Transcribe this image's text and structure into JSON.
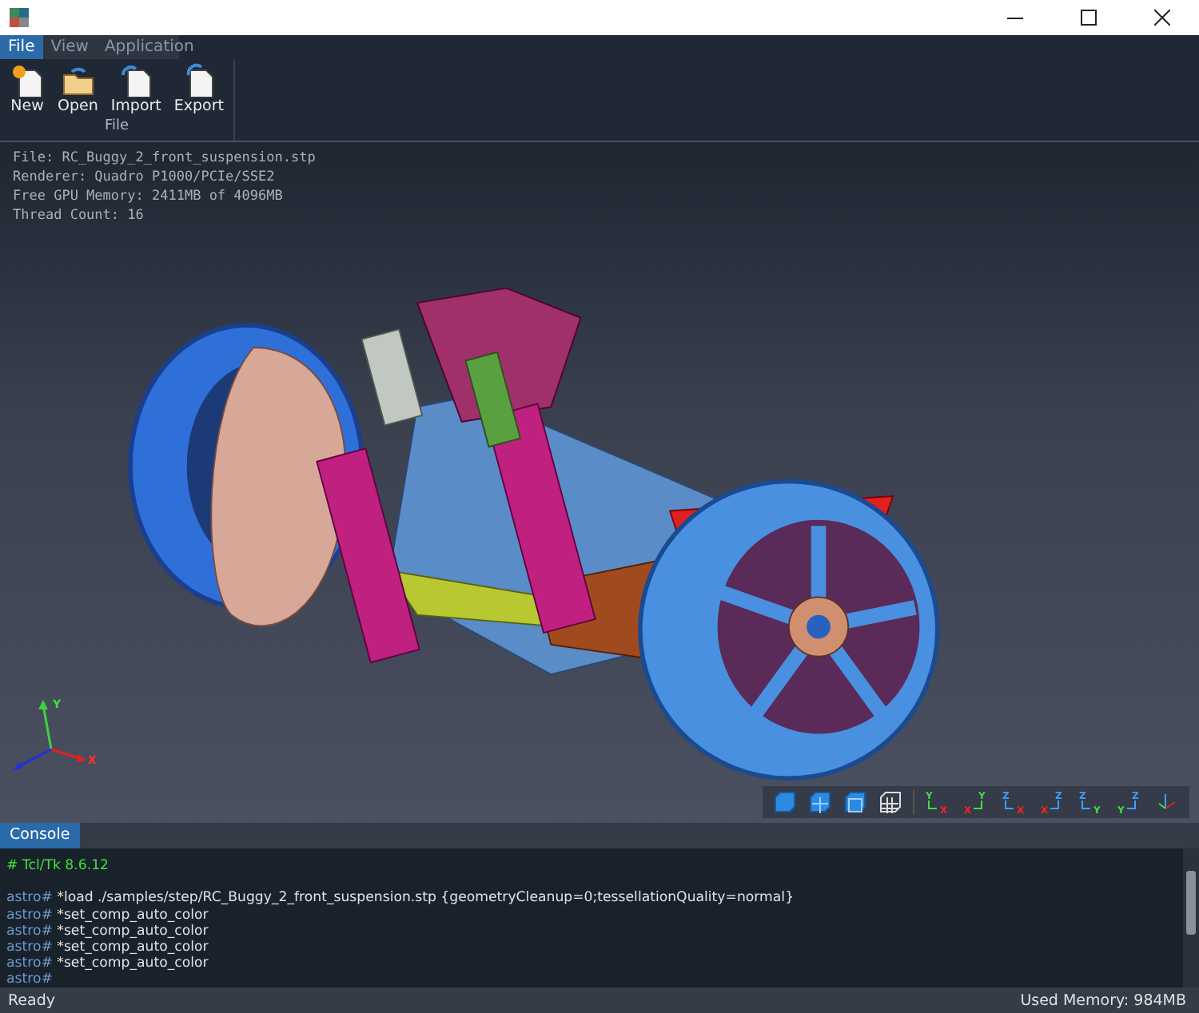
{
  "menu_tabs": [
    {
      "label": "File",
      "selected": true
    },
    {
      "label": "View",
      "selected": false
    },
    {
      "label": "Application",
      "selected": false
    }
  ],
  "ribbon": {
    "buttons": [
      {
        "label": "New",
        "kind": "new"
      },
      {
        "label": "Open",
        "kind": "open"
      },
      {
        "label": "Import",
        "kind": "import"
      },
      {
        "label": "Export",
        "kind": "export"
      }
    ],
    "group_label": "File"
  },
  "viewport_info": [
    "File: RC_Buggy_2_front_suspension.stp",
    "Renderer: Quadro P1000/PCIe/SSE2",
    "Free GPU Memory: 2411MB of 4096MB",
    "Thread Count: 16"
  ],
  "axis_triad": {
    "y_label": "Y",
    "x_label": "X"
  },
  "view_buttons": [
    {
      "kind": "shaded"
    },
    {
      "kind": "shaded-edges"
    },
    {
      "kind": "shaded-outline"
    },
    {
      "kind": "wireframe"
    }
  ],
  "axis_views": [
    {
      "up": "Y",
      "side": "X"
    },
    {
      "up": "Y",
      "side": "X"
    },
    {
      "up": "Z",
      "side": "X"
    },
    {
      "up": "Z",
      "side": "X"
    },
    {
      "up": "Z",
      "side": "Y"
    },
    {
      "up": "Z",
      "side": "Y"
    }
  ],
  "console_tab": {
    "label": "Console",
    "selected": true
  },
  "console_lines": [
    {
      "kind": "comment",
      "text": "# Tcl/Tk 8.6.12"
    },
    {
      "kind": "blank"
    },
    {
      "kind": "command",
      "prompt": "astro#",
      "text": "*load ./samples/step/RC_Buggy_2_front_suspension.stp {geometryCleanup=0;tessellationQuality=normal}"
    },
    {
      "kind": "command",
      "prompt": "astro#",
      "text": "*set_comp_auto_color"
    },
    {
      "kind": "command",
      "prompt": "astro#",
      "text": "*set_comp_auto_color"
    },
    {
      "kind": "command",
      "prompt": "astro#",
      "text": "*set_comp_auto_color"
    },
    {
      "kind": "command",
      "prompt": "astro#",
      "text": "*set_comp_auto_color"
    },
    {
      "kind": "command",
      "prompt": "astro#"
    }
  ],
  "status_bar": {
    "left": "Ready",
    "right": "Used Memory: 984MB"
  }
}
